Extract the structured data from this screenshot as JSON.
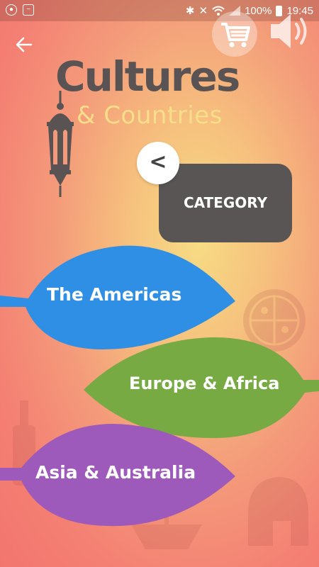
{
  "status_bar": {
    "battery": "100%",
    "time": "19:45",
    "icons": [
      "notification-icon",
      "activity-icon",
      "bluetooth-icon",
      "mute-icon",
      "wifi-icon",
      "signal-icon",
      "battery-icon"
    ]
  },
  "header": {
    "back_icon": "arrow-left-icon",
    "cart_icon": "shopping-cart-icon",
    "sound_icon": "speaker-icon"
  },
  "title": {
    "line1": "Cultures",
    "line2": "& Countries"
  },
  "category": {
    "back_glyph": "<",
    "label": "CATEGORY"
  },
  "regions": [
    {
      "label": "The Americas",
      "color": "#2f8fe4"
    },
    {
      "label": "Europe & Africa",
      "color": "#78aa44"
    },
    {
      "label": "Asia & Australia",
      "color": "#9d5aba"
    }
  ],
  "colors": {
    "background_primary": "#f47f73",
    "background_highlight": "#f7dc84",
    "title_dark": "#595453",
    "title_yellow": "#f7df8a",
    "category_box": "#595555"
  }
}
